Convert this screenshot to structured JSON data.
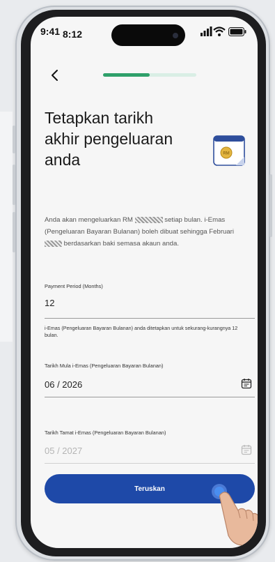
{
  "status": {
    "time_overlay": "9:41",
    "time": "8:12"
  },
  "header": {
    "progress_fraction": 0.5
  },
  "page": {
    "title": "Tetapkan tarikh akhir pengeluaran anda"
  },
  "description": {
    "part1": "Anda akan mengeluarkan RM",
    "part2": "setiap bulan. i-Emas (Pengeluaran Bayaran Bulanan) boleh dibuat sehingga Februari",
    "part3": "berdasarkan baki semasa akaun anda."
  },
  "fields": {
    "payment_period": {
      "label": "Payment Period (Months)",
      "value": "12",
      "helper": "i-Emas (Pengeluaran Bayaran Bulanan) anda ditetapkan untuk sekurang-kurangnya 12 bulan."
    },
    "start_date": {
      "label": "Tarikh Mula i-Emas (Pengeluaran Bayaran Bulanan)",
      "value": "06 / 2026"
    },
    "end_date": {
      "label": "Tarikh Tamat i-Emas (Pengeluaran Bayaran Bulanan)",
      "value": "05 / 2027"
    }
  },
  "actions": {
    "continue_label": "Teruskan"
  },
  "colors": {
    "primary": "#1e49a8",
    "progress": "#2fa06a",
    "background": "#f6f6f6"
  },
  "icons": {
    "back": "chevron-left-icon",
    "calendar_illustration": "calendar-coin-icon",
    "field_calendar": "calendar-icon"
  }
}
